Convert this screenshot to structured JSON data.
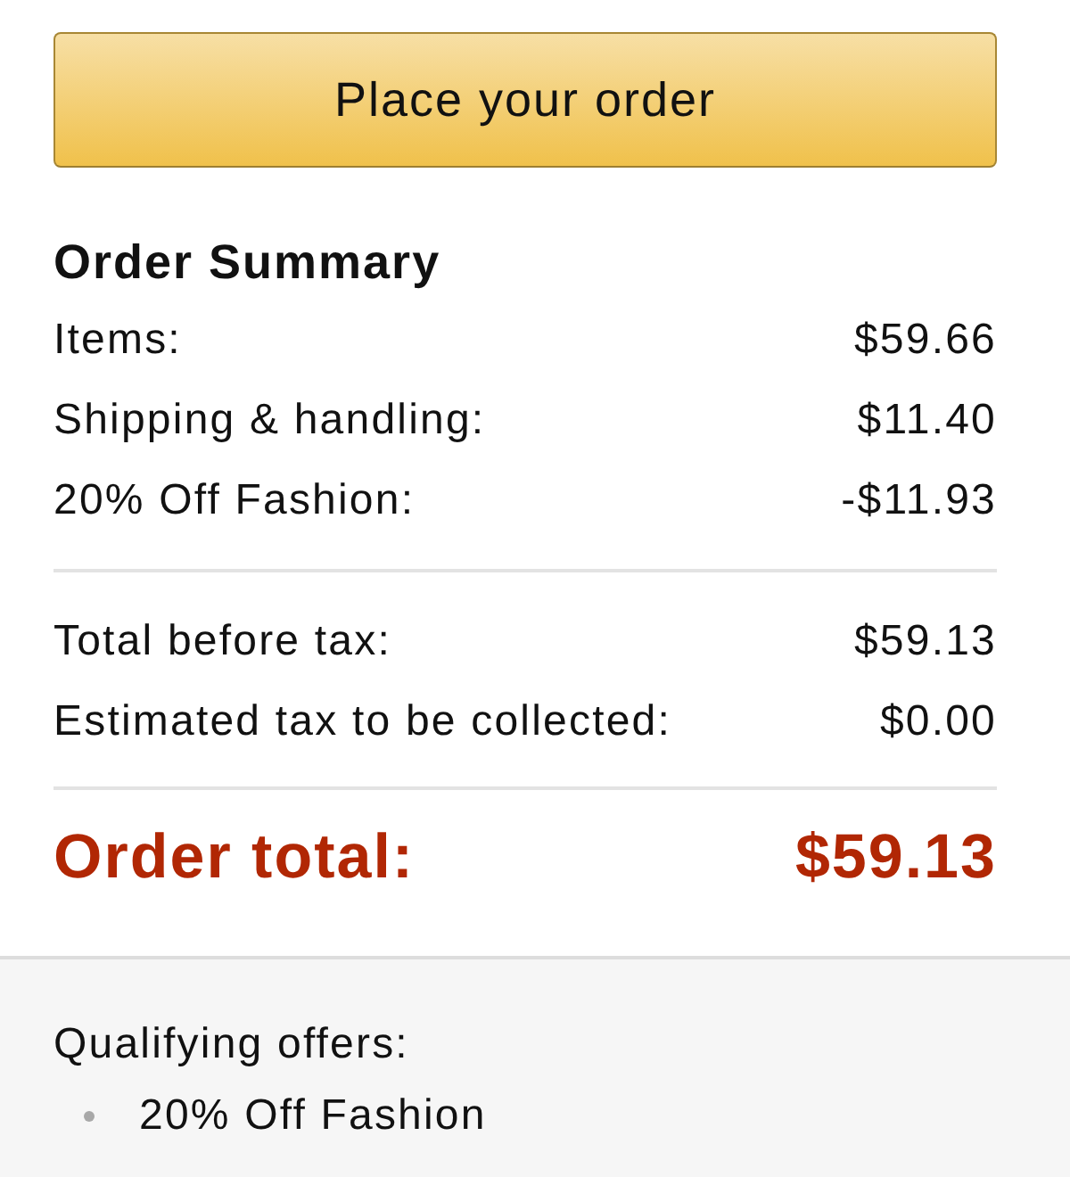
{
  "place_order_button": {
    "label": "Place your order"
  },
  "order_summary": {
    "title": "Order Summary",
    "lines": [
      {
        "label": "Items:",
        "amount": "$59.66"
      },
      {
        "label": "Shipping & handling:",
        "amount": "$11.40"
      },
      {
        "label": "20% Off Fashion:",
        "amount": "-$11.93"
      }
    ],
    "tax_lines": [
      {
        "label": "Total before tax:",
        "amount": "$59.13"
      },
      {
        "label": "Estimated tax to be collected:",
        "amount": "$0.00"
      }
    ],
    "total": {
      "label": "Order total:",
      "amount": "$59.13"
    }
  },
  "qualifying_offers": {
    "title": "Qualifying offers:",
    "items": [
      "20% Off Fashion"
    ]
  }
}
